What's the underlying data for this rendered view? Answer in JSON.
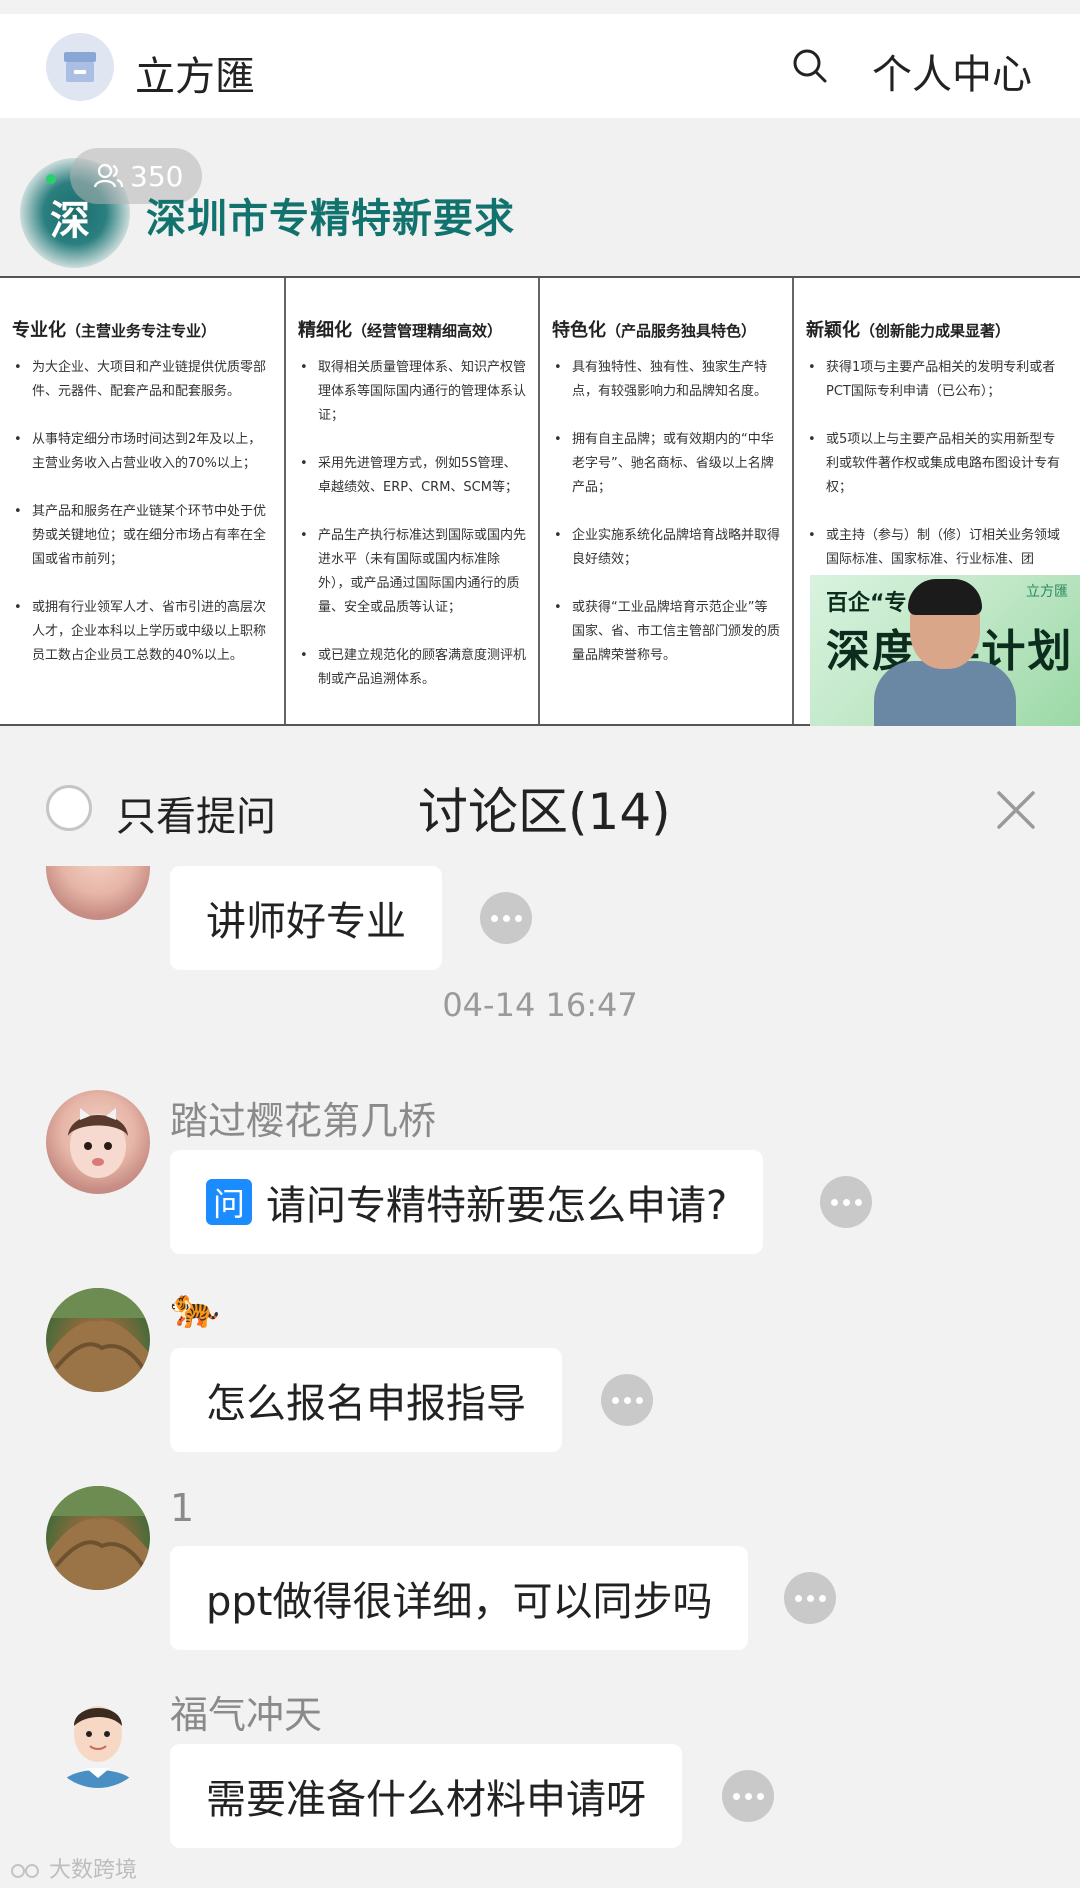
{
  "header": {
    "app_title": "立方匯",
    "profile_label": "个人中心"
  },
  "slide": {
    "viewer_count": "350",
    "badge_char": "深",
    "title": "深圳市专精特新要求",
    "columns": [
      {
        "heading": "专业化",
        "sub": "（主营业务专注专业）",
        "items": [
          "为大企业、大项目和产业链提供优质零部件、元器件、配套产品和配套服务。",
          "从事特定细分市场时间达到2年及以上，主营业务收入占营业收入的70%以上；",
          "其产品和服务在产业链某个环节中处于优势或关键地位；或在细分市场占有率在全国或省市前列；",
          "或拥有行业领军人才、省市引进的高层次人才，企业本科以上学历或中级以上职称员工数占企业员工总数的40%以上。"
        ]
      },
      {
        "heading": "精细化",
        "sub": "（经营管理精细高效）",
        "items": [
          "取得相关质量管理体系、知识产权管理体系等国际国内通行的管理体系认证；",
          "采用先进管理方式，例如5S管理、卓越绩效、ERP、CRM、SCM等；",
          "产品生产执行标准达到国际或国内先进水平（未有国际或国内标准除外），或产品通过国际国内通行的质量、安全或品质等认证；",
          "或已建立规范化的顾客满意度测评机制或产品追溯体系。"
        ]
      },
      {
        "heading": "特色化",
        "sub": "（产品服务独具特色）",
        "items": [
          "具有独特性、独有性、独家生产特点，有较强影响力和品牌知名度。",
          "拥有自主品牌；或有效期内的“中华老字号”、驰名商标、省级以上名牌产品；",
          "企业实施系统化品牌培育战略并取得良好绩效；",
          "或获得“工业品牌培育示范企业”等国家、省、市工信主管部门颁发的质量品牌荣誉称号。"
        ]
      },
      {
        "heading": "新颖化",
        "sub": "（创新能力成果显著）",
        "items": [
          "获得1项与主要产品相关的发明专利或者PCT国际专利申请（已公布）；",
          "或5项以上与主要产品相关的实用新型专利或软件著作权或集成电路布图设计专有权；",
          "或主持（参与）制（修）订相关业务领域国际标准、国家标准、行业标准、团"
        ]
      }
    ],
    "presenter": {
      "banner_small": "百企“专",
      "banner_large": "深度  伴计划",
      "brand": "立方匯"
    }
  },
  "discussion": {
    "only_questions_label": "只看提问",
    "title": "讨论区(14)",
    "messages": [
      {
        "nickname": "",
        "text": "讲师好专业"
      },
      {
        "timestamp": "04-14 16:47"
      },
      {
        "nickname": "踏过樱花第几桥",
        "question_badge": "问",
        "text": "请问专精特新要怎么申请?"
      },
      {
        "nickname": "🐅",
        "text": "怎么报名申报指导"
      },
      {
        "nickname": "1",
        "text": "ppt做得很详细，可以同步吗"
      },
      {
        "nickname": "福气冲天",
        "text": "需要准备什么材料申请呀"
      }
    ]
  },
  "watermark": "大数跨境",
  "colors": {
    "accent_teal": "#12736e",
    "question_badge_blue": "#1a8cff",
    "background": "#f2f2f2"
  }
}
